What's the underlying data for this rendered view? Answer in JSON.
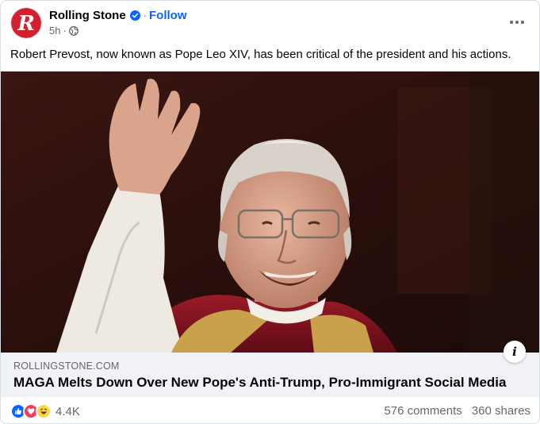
{
  "post": {
    "page_name": "Rolling Stone",
    "follow_label": "Follow",
    "time": "5h",
    "caption": "Robert Prevost, now known as Pope Leo XIV, has been critical of the president and his actions.",
    "avatar_letter": "R"
  },
  "link": {
    "domain": "ROLLINGSTONE.COM",
    "title": "MAGA Melts Down Over New Pope's Anti-Trump, Pro-Immigrant Social Media",
    "info_label": "i"
  },
  "footer": {
    "reaction_count": "4.4K",
    "comments": "576 comments",
    "shares": "360 shares"
  },
  "icons": {
    "verified": "verified-badge-icon",
    "globe": "globe-icon",
    "more": "more-options-icon",
    "like": "like-reaction-icon",
    "love": "love-reaction-icon",
    "haha": "haha-reaction-icon"
  },
  "colors": {
    "accent": "#0866ff",
    "brand_red": "#d3202f",
    "secondary_text": "#65676b",
    "link_bg": "#f0f2f5"
  }
}
